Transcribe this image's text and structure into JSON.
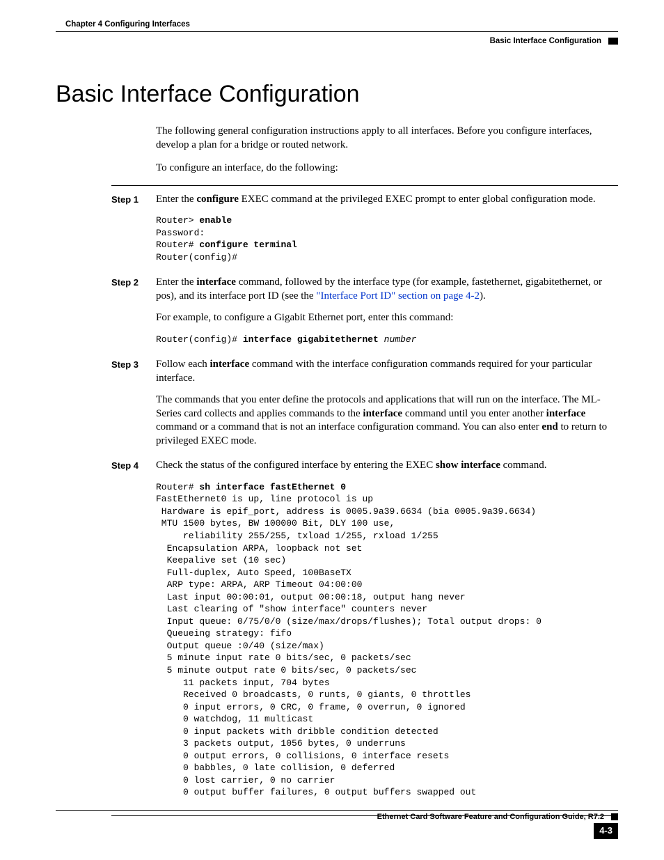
{
  "header": {
    "chapter": "Chapter 4    Configuring Interfaces",
    "section": "Basic Interface Configuration"
  },
  "title": "Basic Interface Configuration",
  "intro1": "The following general configuration instructions apply to all interfaces. Before you configure interfaces, develop a plan for a bridge or routed network.",
  "intro2": "To configure an interface, do the following:",
  "steps": [
    {
      "label": "Step 1",
      "p1a": "Enter the ",
      "p1b": "configure",
      "p1c": " EXEC command at the privileged EXEC prompt to enter global configuration mode.",
      "code_plain1": "Router> ",
      "code_bold1": "enable",
      "code_line2": "Password:",
      "code_plain3": "Router# ",
      "code_bold3": "configure terminal",
      "code_line4": "Router(config)#"
    },
    {
      "label": "Step 2",
      "p1a": "Enter the ",
      "p1b": "interface",
      "p1c": " command, followed by the interface type (for example, fastethernet, gigabitethernet, or pos), and its interface port ID (see the ",
      "p1link": "\"Interface Port ID\" section on page 4-2",
      "p1d": ").",
      "p2": "For example, to configure a Gigabit Ethernet port, enter this command:",
      "code_plain1": "Router(config)# ",
      "code_bold1": "interface gigabitethernet",
      "code_italic1": " number"
    },
    {
      "label": "Step 3",
      "p1a": "Follow each ",
      "p1b": "interface",
      "p1c": " command with the interface configuration commands required for your particular interface.",
      "p2a": "The commands that you enter define the protocols and applications that will run on the interface. The ML-Series card collects and applies commands to the ",
      "p2b": "interface",
      "p2c": " command until you enter another ",
      "p2d": "interface",
      "p2e": " command or a command that is not an interface configuration command. You can also enter ",
      "p2f": "end",
      "p2g": " to return to privileged EXEC mode."
    },
    {
      "label": "Step 4",
      "p1a": "Check the status of the configured interface by entering the EXEC ",
      "p1b": "show interface",
      "p1c": " command.",
      "code_plain1": "Router# ",
      "code_bold1": "sh interface fastEthernet 0",
      "code_rest": "FastEthernet0 is up, line protocol is up\n Hardware is epif_port, address is 0005.9a39.6634 (bia 0005.9a39.6634)\n MTU 1500 bytes, BW 100000 Bit, DLY 100 use,\n     reliability 255/255, txload 1/255, rxload 1/255\n  Encapsulation ARPA, loopback not set\n  Keepalive set (10 sec)\n  Full-duplex, Auto Speed, 100BaseTX\n  ARP type: ARPA, ARP Timeout 04:00:00\n  Last input 00:00:01, output 00:00:18, output hang never\n  Last clearing of \"show interface\" counters never\n  Input queue: 0/75/0/0 (size/max/drops/flushes); Total output drops: 0\n  Queueing strategy: fifo\n  Output queue :0/40 (size/max)\n  5 minute input rate 0 bits/sec, 0 packets/sec\n  5 minute output rate 0 bits/sec, 0 packets/sec\n     11 packets input, 704 bytes\n     Received 0 broadcasts, 0 runts, 0 giants, 0 throttles\n     0 input errors, 0 CRC, 0 frame, 0 overrun, 0 ignored\n     0 watchdog, 11 multicast\n     0 input packets with dribble condition detected\n     3 packets output, 1056 bytes, 0 underruns\n     0 output errors, 0 collisions, 0 interface resets\n     0 babbles, 0 late collision, 0 deferred\n     0 lost carrier, 0 no carrier\n     0 output buffer failures, 0 output buffers swapped out"
    }
  ],
  "footer": {
    "guide": "Ethernet Card Software Feature and Configuration Guide, R7.2",
    "pagenum": "4-3"
  }
}
